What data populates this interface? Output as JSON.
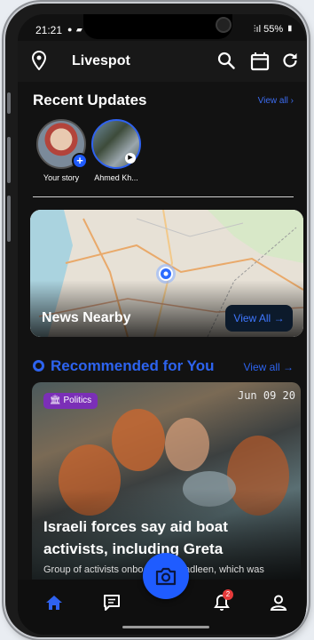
{
  "status_bar": {
    "time": "21:21",
    "battery": "55%"
  },
  "app_bar": {
    "title": "Livespot",
    "icons": [
      "location-pin-icon",
      "search-icon",
      "calendar-icon",
      "refresh-icon"
    ]
  },
  "recent_updates": {
    "title": "Recent Updates",
    "view_all": "View all",
    "stories": [
      {
        "label": "Your story"
      },
      {
        "label": "Ahmed Kh..."
      }
    ]
  },
  "map_card": {
    "title": "News Nearby",
    "view_all": "View All"
  },
  "recommended": {
    "title": "Recommended for You",
    "view_all": "View all",
    "article": {
      "category": "Politics",
      "date": "Jun 09 20",
      "headline": "Israeli forces say aid boat activists, including Greta",
      "subtitle": "Group of activists onboard the Madleen, which was"
    }
  },
  "bottom_nav": {
    "notification_count": "2",
    "items": [
      "home-icon",
      "chat-icon",
      "camera-icon",
      "bell-icon",
      "profile-icon"
    ]
  },
  "colors": {
    "accent": "#2d63ee",
    "badge": "#7b2fb7",
    "alert": "#e63a3a"
  }
}
